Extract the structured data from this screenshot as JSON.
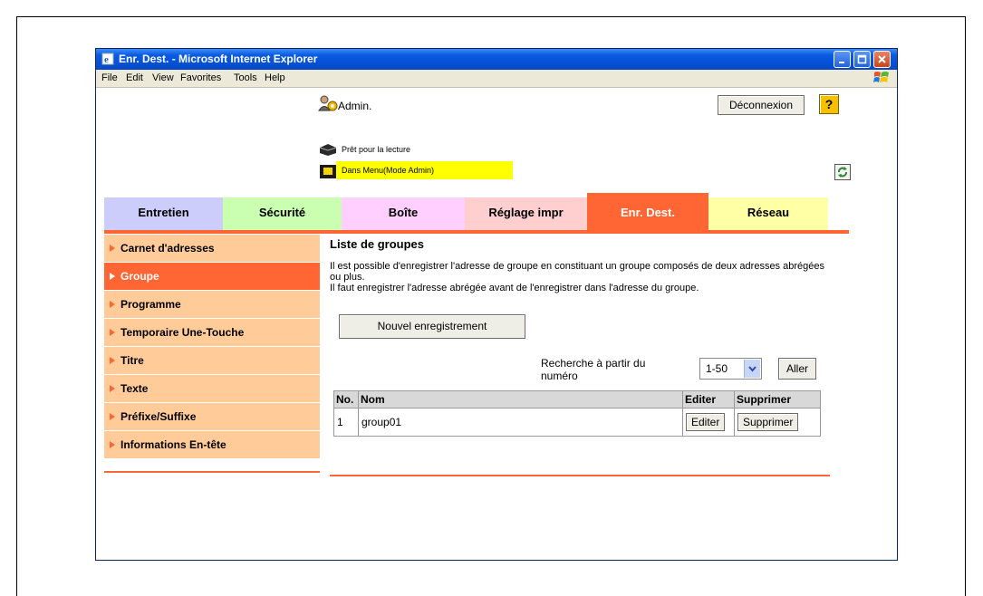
{
  "window": {
    "title": "Enr. Dest. - Microsoft Internet Explorer",
    "menu": [
      "File",
      "Edit",
      "View",
      "Favorites",
      "Tools",
      "Help"
    ]
  },
  "header": {
    "user": "Admin.",
    "logout_label": "Déconnexion",
    "help_label": "?",
    "status_ready": "Prêt pour la lecture",
    "status_mode": "Dans Menu(Mode Admin)"
  },
  "tabs": [
    {
      "label": "Entretien"
    },
    {
      "label": "Sécurité"
    },
    {
      "label": "Boîte"
    },
    {
      "label": "Réglage impr"
    },
    {
      "label": "Enr. Dest."
    },
    {
      "label": "Réseau"
    }
  ],
  "sidebar": {
    "items": [
      {
        "label": "Carnet d'adresses"
      },
      {
        "label": "Groupe"
      },
      {
        "label": "Programme"
      },
      {
        "label": "Temporaire Une-Touche"
      },
      {
        "label": "Titre"
      },
      {
        "label": "Texte"
      },
      {
        "label": "Préfixe/Suffixe"
      },
      {
        "label": "Informations En-tête"
      }
    ]
  },
  "main": {
    "title": "Liste de groupes",
    "desc1": "Il est possible d'enregistrer l'adresse de groupe en constituant un groupe composés de deux adresses abrégées ou plus.",
    "desc2": "Il faut enregistrer l'adresse abrégée avant de l'enregistrer dans l'adresse du groupe.",
    "new_button": "Nouvel enregistrement",
    "search_label": "Recherche à partir du numéro",
    "range_value": "1-50",
    "go_button": "Aller",
    "table": {
      "headers": [
        "No.",
        "Nom",
        "Editer",
        "Supprimer"
      ],
      "rows": [
        {
          "no": "1",
          "name": "group01",
          "edit": "Editer",
          "delete": "Supprimer"
        }
      ]
    }
  },
  "colors": {
    "accent": "#ff6633",
    "sidebar_bg": "#ffcc99",
    "status_highlight": "#ffff00"
  }
}
